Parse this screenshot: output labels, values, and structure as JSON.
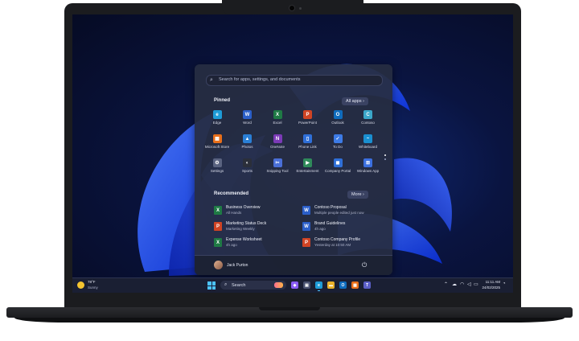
{
  "start_menu": {
    "search_placeholder": "Search for apps, settings, and documents",
    "pinned_title": "Pinned",
    "all_apps_label": "All apps",
    "pinned_apps": [
      {
        "label": "Edge",
        "icon": "edge-icon",
        "color": "#1e9bd7",
        "glyph": "e"
      },
      {
        "label": "Word",
        "icon": "word-icon",
        "color": "#2b5fc9",
        "glyph": "W"
      },
      {
        "label": "Excel",
        "icon": "excel-icon",
        "color": "#1f7a45",
        "glyph": "X"
      },
      {
        "label": "PowerPoint",
        "icon": "powerpoint-icon",
        "color": "#d04424",
        "glyph": "P"
      },
      {
        "label": "Outlook",
        "icon": "outlook-icon",
        "color": "#0f6cbd",
        "glyph": "O"
      },
      {
        "label": "Contoso",
        "icon": "contoso-icon",
        "color": "#3ba7c9",
        "glyph": "C"
      },
      {
        "label": "Microsoft Store",
        "icon": "store-icon",
        "color": "#e86f1a",
        "glyph": "▦"
      },
      {
        "label": "Photos",
        "icon": "photos-icon",
        "color": "#2a7fd6",
        "glyph": "▲"
      },
      {
        "label": "OneNote",
        "icon": "onenote-icon",
        "color": "#7b3ab6",
        "glyph": "N"
      },
      {
        "label": "Phone Link",
        "icon": "phone-link-icon",
        "color": "#2f6fd8",
        "glyph": "▯"
      },
      {
        "label": "To Do",
        "icon": "todo-icon",
        "color": "#3d7be6",
        "glyph": "✓"
      },
      {
        "label": "Whiteboard",
        "icon": "whiteboard-icon",
        "color": "#1a8fd0",
        "glyph": "~"
      },
      {
        "label": "Settings",
        "icon": "settings-icon",
        "color": "#5a6380",
        "glyph": "⚙"
      },
      {
        "label": "Sports",
        "icon": "sports-icon",
        "color": "#2b2f3a",
        "glyph": "◐"
      },
      {
        "label": "Snipping Tool",
        "icon": "snipping-tool-icon",
        "color": "#4a6fd8",
        "glyph": "✂"
      },
      {
        "label": "Entertainment",
        "icon": "entertainment-icon",
        "color": "#2f8a5a",
        "glyph": "▶"
      },
      {
        "label": "Company Portal",
        "icon": "company-portal-icon",
        "color": "#2f6fd8",
        "glyph": "◼"
      },
      {
        "label": "Windows App",
        "icon": "windows-app-icon",
        "color": "#3b6fe0",
        "glyph": "⊞"
      }
    ],
    "recommended_title": "Recommended",
    "more_label": "More",
    "recommended": [
      {
        "name": "Business Overview",
        "sub": "All Hands",
        "icon": "excel-file-icon",
        "color": "#1f7a45",
        "glyph": "X"
      },
      {
        "name": "Contoso Proposal",
        "sub": "Multiple people edited just now",
        "icon": "word-file-icon",
        "color": "#2b5fc9",
        "glyph": "W"
      },
      {
        "name": "Marketing Status Deck",
        "sub": "Marketing Weekly",
        "icon": "powerpoint-file-icon",
        "color": "#d04424",
        "glyph": "P"
      },
      {
        "name": "Brand Guidelines",
        "sub": "4h ago",
        "icon": "word-file-icon",
        "color": "#2b5fc9",
        "glyph": "W"
      },
      {
        "name": "Expense Worksheet",
        "sub": "4h ago",
        "icon": "excel-file-icon",
        "color": "#1f7a45",
        "glyph": "X"
      },
      {
        "name": "Contoso Company Profile",
        "sub": "Yesterday at 10:50 AM",
        "icon": "powerpoint-file-icon",
        "color": "#d04424",
        "glyph": "P"
      }
    ],
    "user_name": "Jack Purton"
  },
  "taskbar": {
    "weather_temp": "78°F",
    "weather_desc": "Sunny",
    "search_label": "Search",
    "time": "11:11 AM",
    "date": "24/02/2025",
    "apps": [
      {
        "icon": "copilot-icon",
        "color": "#8a5cf6",
        "glyph": "◆"
      },
      {
        "icon": "task-view-icon",
        "color": "#4a5270",
        "glyph": "▣"
      },
      {
        "icon": "edge-icon",
        "color": "#1e9bd7",
        "glyph": "e"
      },
      {
        "icon": "file-explorer-icon",
        "color": "#e8b02a",
        "glyph": "▬"
      },
      {
        "icon": "outlook-icon",
        "color": "#0f6cbd",
        "glyph": "O"
      },
      {
        "icon": "store-icon",
        "color": "#e86f1a",
        "glyph": "▦"
      },
      {
        "icon": "teams-icon",
        "color": "#5b5fc7",
        "glyph": "T"
      }
    ]
  }
}
